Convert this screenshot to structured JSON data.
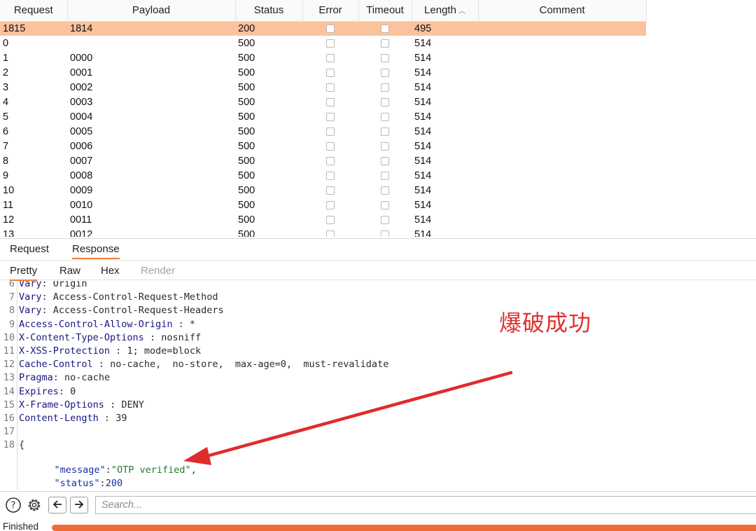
{
  "table": {
    "columns": [
      "Request",
      "Payload",
      "Status",
      "Error",
      "Timeout",
      "Length",
      "Comment"
    ],
    "rows": [
      {
        "request": "1815",
        "payload": "1814",
        "status": "200",
        "length": "495",
        "selected": true
      },
      {
        "request": "0",
        "payload": "",
        "status": "500",
        "length": "514"
      },
      {
        "request": "1",
        "payload": "0000",
        "status": "500",
        "length": "514"
      },
      {
        "request": "2",
        "payload": "0001",
        "status": "500",
        "length": "514"
      },
      {
        "request": "3",
        "payload": "0002",
        "status": "500",
        "length": "514"
      },
      {
        "request": "4",
        "payload": "0003",
        "status": "500",
        "length": "514"
      },
      {
        "request": "5",
        "payload": "0004",
        "status": "500",
        "length": "514"
      },
      {
        "request": "6",
        "payload": "0005",
        "status": "500",
        "length": "514"
      },
      {
        "request": "7",
        "payload": "0006",
        "status": "500",
        "length": "514"
      },
      {
        "request": "8",
        "payload": "0007",
        "status": "500",
        "length": "514"
      },
      {
        "request": "9",
        "payload": "0008",
        "status": "500",
        "length": "514"
      },
      {
        "request": "10",
        "payload": "0009",
        "status": "500",
        "length": "514"
      },
      {
        "request": "11",
        "payload": "0010",
        "status": "500",
        "length": "514"
      },
      {
        "request": "12",
        "payload": "0011",
        "status": "500",
        "length": "514"
      },
      {
        "request": "13",
        "payload": "0012",
        "status": "500",
        "length": "514"
      }
    ],
    "selected_color": "#fbc39c"
  },
  "tabs": {
    "main": [
      "Request",
      "Response"
    ],
    "active_main": "Response",
    "view": [
      "Pretty",
      "Raw",
      "Hex",
      "Render"
    ],
    "active_view": "Pretty"
  },
  "response": {
    "lines": [
      {
        "n": "6",
        "key": "Vary",
        "sep": ": ",
        "value": "Origin"
      },
      {
        "n": "7",
        "key": "Vary",
        "sep": ": ",
        "value": "Access-Control-Request-Method"
      },
      {
        "n": "8",
        "key": "Vary",
        "sep": ": ",
        "value": "Access-Control-Request-Headers"
      },
      {
        "n": "9",
        "key": "Access-Control-Allow-Origin",
        "sep": " : ",
        "value": "*"
      },
      {
        "n": "10",
        "key": "X-Content-Type-Options",
        "sep": " : ",
        "value": "nosniff"
      },
      {
        "n": "11",
        "key": "X-XSS-Protection",
        "sep": " : ",
        "value": "1; mode=block"
      },
      {
        "n": "12",
        "key": "Cache-Control",
        "sep": " : ",
        "value": "no-cache,  no-store,  max-age=0,  must-revalidate"
      },
      {
        "n": "13",
        "key": "Pragma",
        "sep": ": ",
        "value": "no-cache"
      },
      {
        "n": "14",
        "key": "Expires",
        "sep": ": ",
        "value": "0"
      },
      {
        "n": "15",
        "key": "X-Frame-Options",
        "sep": " : ",
        "value": "DENY"
      },
      {
        "n": "16",
        "key": "Content-Length",
        "sep": " : ",
        "value": "39"
      },
      {
        "n": "17",
        "key": "",
        "sep": "",
        "value": ""
      },
      {
        "n": "18",
        "key": "",
        "sep": "",
        "value": "{"
      }
    ],
    "json_message_key": "\"message\"",
    "json_message_value": "\"OTP verified\"",
    "json_status_key": "\"status\"",
    "json_status_value": "200",
    "json_close": "}"
  },
  "annotation": {
    "text": "爆破成功",
    "color": "#e03131"
  },
  "toolbar": {
    "search_placeholder": "Search..."
  },
  "status": {
    "text": "Finished",
    "progress": 1.0,
    "color": "#ee6b36"
  },
  "icons": [
    "help-icon",
    "gear-icon",
    "arrow-left-icon",
    "arrow-right-icon",
    "sort-ascending-icon",
    "checkbox-icon"
  ]
}
